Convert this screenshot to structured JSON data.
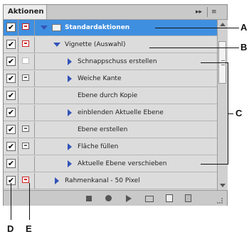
{
  "panel": {
    "tab_label": "Aktionen",
    "tab_controls": {
      "forward": "▸▸",
      "menu": "≡"
    }
  },
  "rows": [
    {
      "check": "✔",
      "dialog": "red",
      "expander": "down",
      "folder": true,
      "label": "Standardaktionen",
      "selected": true
    },
    {
      "check": "✔",
      "dialog": "red",
      "expander": "down",
      "label": "Vignette (Auswahl)"
    },
    {
      "check": "✔",
      "dialog": "empty",
      "expander": "right",
      "label": "Schnappschuss erstellen"
    },
    {
      "check": "✔",
      "dialog": "gray",
      "expander": "right",
      "label": "Weiche Kante"
    },
    {
      "check": "✔",
      "dialog": "none",
      "expander": "none",
      "label": "Ebene durch Kopie"
    },
    {
      "check": "✔",
      "dialog": "none",
      "expander": "right",
      "label": "einblenden Aktuelle Ebene"
    },
    {
      "check": "✔",
      "dialog": "gray",
      "expander": "none",
      "label": "Ebene erstellen"
    },
    {
      "check": "✔",
      "dialog": "gray",
      "expander": "right",
      "label": "Fläche füllen"
    },
    {
      "check": "✔",
      "dialog": "none",
      "expander": "right",
      "label": "Aktuelle Ebene verschieben"
    },
    {
      "check": "✔",
      "dialog": "red",
      "expander": "right",
      "label": "Rahmenkanal - 50 Pixel"
    }
  ],
  "callouts": {
    "a": "A",
    "b": "B",
    "c": "C",
    "d": "D",
    "e": "E"
  }
}
